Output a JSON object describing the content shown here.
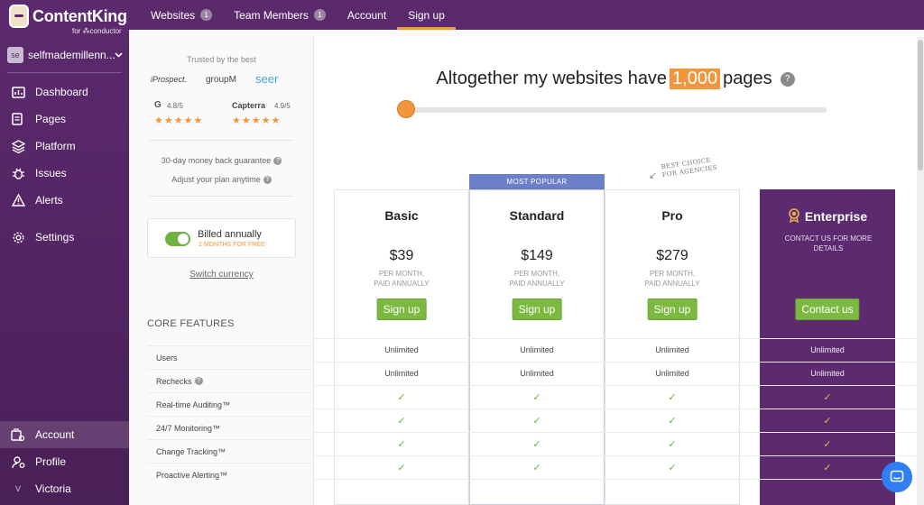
{
  "brand": {
    "name": "ContentKing",
    "for": "for ⁂conductor"
  },
  "account": {
    "initials": "se",
    "name": "selfmademillenn..."
  },
  "sidebar": {
    "items": [
      {
        "label": "Dashboard",
        "icon": "dashboard-icon"
      },
      {
        "label": "Pages",
        "icon": "pages-icon"
      },
      {
        "label": "Platform",
        "icon": "platform-icon"
      },
      {
        "label": "Issues",
        "icon": "bug-icon"
      },
      {
        "label": "Alerts",
        "icon": "warning-icon"
      },
      {
        "label": "Settings",
        "icon": "gear-icon"
      }
    ],
    "bottom": [
      {
        "label": "Account",
        "icon": "account-icon"
      },
      {
        "label": "Profile",
        "icon": "profile-icon"
      },
      {
        "label": "Victoria",
        "icon": "user-initial-icon",
        "initial": "V"
      }
    ]
  },
  "topbar": {
    "tabs": [
      {
        "label": "Websites",
        "badge": "1"
      },
      {
        "label": "Team Members",
        "badge": "1"
      },
      {
        "label": "Account"
      },
      {
        "label": "Sign up",
        "active": true
      }
    ]
  },
  "panel": {
    "trusted": "Trusted by the best",
    "logos": [
      "iProspect.",
      "groupM",
      "seer"
    ],
    "ratings": [
      {
        "name": "G",
        "score": "4.8/5"
      },
      {
        "name": "Capterra",
        "score": "4.9/5"
      }
    ],
    "stars": "★★★★★",
    "guarantee": "30-day money back guarantee",
    "adjust": "Adjust your plan anytime",
    "billing_label": "Billed annually",
    "billing_sub": "2 MONTHS FOR FREE",
    "switch_currency": "Switch currency",
    "core_features": "CORE FEATURES",
    "features": [
      "Users",
      "Rechecks",
      "Real-time Auditing™",
      "24/7 Monitoring™",
      "Change Tracking™",
      "Proactive Alerting™"
    ]
  },
  "headline": {
    "before": "Altogether my websites have",
    "number": "1,000",
    "after": "pages",
    "help": "?"
  },
  "slider": {
    "value": 1000
  },
  "popular_banner": "MOST POPULAR",
  "best_choice": [
    "BEST CHOICE",
    "FOR AGENCIES"
  ],
  "plans": [
    {
      "name": "Basic",
      "price": "$39",
      "per1": "PER MONTH,",
      "per2": "PAID ANNUALLY",
      "button": "Sign up"
    },
    {
      "name": "Standard",
      "price": "$149",
      "per1": "PER MONTH,",
      "per2": "PAID ANNUALLY",
      "button": "Sign up"
    },
    {
      "name": "Pro",
      "price": "$279",
      "per1": "PER MONTH,",
      "per2": "PAID ANNUALLY",
      "button": "Sign up"
    },
    {
      "name": "Enterprise",
      "desc": "CONTACT US FOR MORE DETAILS",
      "button": "Contact us"
    }
  ],
  "feature_values": {
    "users": "Unlimited",
    "rechecks": "Unlimited",
    "check": "✓"
  },
  "colors": {
    "sidebar": "#5c2a6e",
    "accent": "#f0963c",
    "green": "#7cb940",
    "popular": "#6c7fc9"
  }
}
